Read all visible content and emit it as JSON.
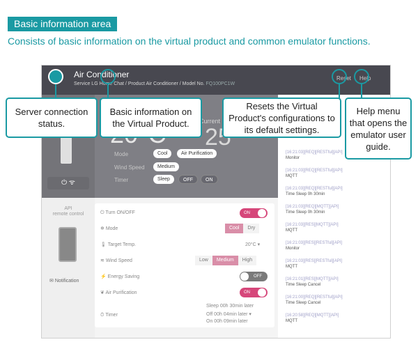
{
  "header": {
    "tag": "Basic information area",
    "subtitle": "Consists of basic information on the virtual product and common emulator functions."
  },
  "app": {
    "title": "Air Conditioner",
    "service_label": "Service",
    "service_value": "LG Home Chat",
    "product_label": "Product",
    "product_value": "Air Conditioner",
    "model_label": "Model No.",
    "model_value": "FQ100PC1W",
    "reset_label": "Reset",
    "help_label": "Help"
  },
  "panel": {
    "temperature": "20°C",
    "current_label": "Current",
    "current_value": "25",
    "mode_label": "Mode",
    "mode_values": [
      "Cool",
      "Air Purification"
    ],
    "wind_label": "Wind Speed",
    "wind_value": "Medium",
    "timer_label": "Timer",
    "timer_values": [
      "Sleep",
      "OFF",
      "ON"
    ],
    "power_wifi": "⏻ ᯤ"
  },
  "api": {
    "label_line1": "API",
    "label_line2": "remote control",
    "notification": "Notification"
  },
  "controls": {
    "turn_on_off": {
      "label": "Turn ON/OFF",
      "value": "ON"
    },
    "mode": {
      "label": "Mode",
      "options": [
        "Cool",
        "Dry"
      ],
      "selected": "Cool"
    },
    "target_temp": {
      "label": "Target Temp.",
      "value": "20°C"
    },
    "wind_speed": {
      "label": "Wind Speed",
      "options": [
        "Low",
        "Medium",
        "High"
      ],
      "selected": "Medium"
    },
    "energy_saving": {
      "label": "Energy Saving",
      "value": "OFF"
    },
    "air_purification": {
      "label": "Air Purification",
      "value": "ON"
    },
    "timer": {
      "label": "Timer",
      "rows": [
        {
          "k": "Sleep",
          "v": "00h 30min later"
        },
        {
          "k": "Off",
          "v": "00h 04min later"
        },
        {
          "k": "On",
          "v": "00h 09min later"
        }
      ]
    }
  },
  "logs": [
    {
      "ts": "[16:21:03][REQ][RESTful][API]",
      "msg": "Monitor"
    },
    {
      "ts": "[16:21:03][REQ][RESTful][API]",
      "msg": "MQTT"
    },
    {
      "ts": "[16:21:03][REQ][RESTful][API]",
      "msg": "Time Sleep 0h 30min"
    },
    {
      "ts": "[16:21:03][REQ][MQTT][API]",
      "msg": "Time Sleep 0h 30min"
    },
    {
      "ts": "[16:21:03][RES][MQTT][API]",
      "msg": "MQTT"
    },
    {
      "ts": "[16:21:03][RES][RESTful][API]",
      "msg": "Monitor"
    },
    {
      "ts": "[16:21:03][RES][RESTful][API]",
      "msg": "MQTT"
    },
    {
      "ts": "[16:21:01][RES][MQTT][API]",
      "msg": "Time Sleep Cancel"
    },
    {
      "ts": "[16:21:00][REQ][RESTful][API]",
      "msg": "Time Sleep Cancel"
    },
    {
      "ts": "[16:20:58][REQ][MQTT][API]",
      "msg": "MQTT"
    }
  ],
  "callouts": {
    "server": "Server connection status.",
    "basic": "Basic information on the Virtual Product.",
    "reset": "Resets the Virtual Product's configurations to its default settings.",
    "help": "Help menu that opens the emulator user guide."
  },
  "colors": {
    "accent": "#1a9aa3",
    "toggle_on": "#d6477a",
    "topbar": "#484850",
    "panel": "#7f7f85"
  }
}
